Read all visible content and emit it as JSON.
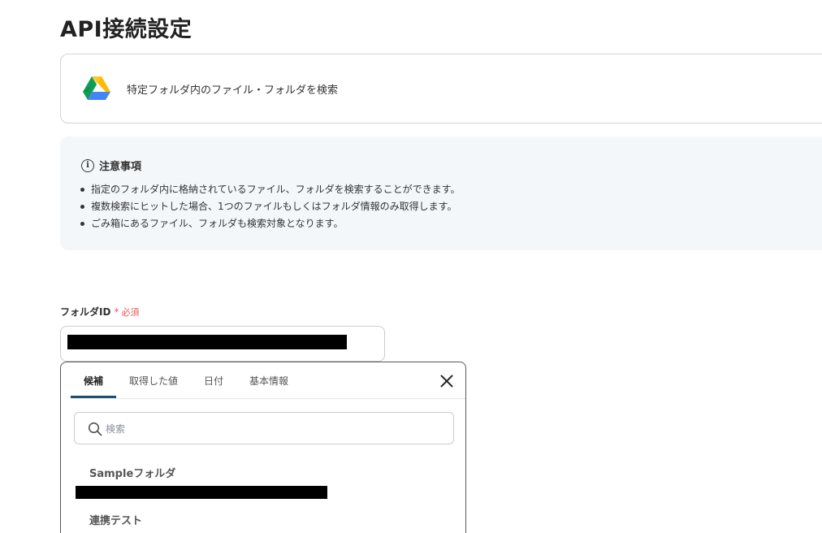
{
  "page": {
    "title": "API接続設定"
  },
  "action": {
    "label": "特定フォルダ内のファイル・フォルダを検索",
    "icon": "google-drive-icon"
  },
  "notice": {
    "title": "注意事項",
    "items": [
      "指定のフォルダ内に格納されているファイル、フォルダを検索することができます。",
      "複数検索にヒットした場合、1つのファイルもしくはフォルダ情報のみ取得します。",
      "ごみ箱にあるファイル、フォルダも検索対象となります。"
    ]
  },
  "field": {
    "label": "フォルダID",
    "required_mark": "*",
    "required_text": "必須"
  },
  "dropdown": {
    "tabs": [
      "候補",
      "取得した値",
      "日付",
      "基本情報"
    ],
    "active_tab": "候補",
    "search_placeholder": "検索",
    "options": [
      "Sampleフォルダ",
      "連携テスト"
    ]
  },
  "colors": {
    "accent": "#1f4f6e",
    "required": "#e45a5a",
    "notice_bg": "#f4f7fa"
  }
}
